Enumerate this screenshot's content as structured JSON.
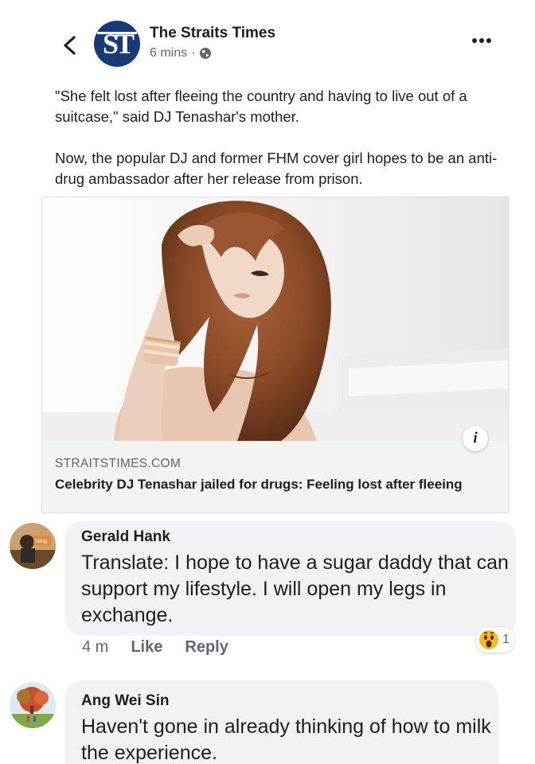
{
  "post": {
    "page_name": "The Straits Times",
    "logo_text": "ST",
    "time": "6 mins",
    "separator": "·",
    "paragraphs": [
      "\"She felt lost after fleeing the country and having to live out of a suitcase,\" said DJ Tenashar's mother.",
      "Now, the popular DJ and former FHM cover girl hopes to be an anti-drug ambassador after her release from prison."
    ],
    "link": {
      "domain": "STRAITSTIMES.COM",
      "title": "Celebrity DJ Tenashar jailed for drugs: Feeling lost after fleeing",
      "info_icon": "i"
    }
  },
  "comments": [
    {
      "name": "Gerald Hank",
      "avatar_label": "Yang",
      "text": "Translate: I hope to have a sugar daddy that can support my lifestyle. I will open my legs in exchange.",
      "time": "4 m",
      "like_label": "Like",
      "reply_label": "Reply",
      "reaction_icon": "wow-icon",
      "reaction_count": "1"
    },
    {
      "name": "Ang Wei Sin",
      "text": "Haven't gone in already thinking of how to milk the experience."
    }
  ],
  "colors": {
    "logo": "#1b3a75",
    "meta_text": "#606770",
    "bubble": "#f0f2f5",
    "wow": "#f7b928"
  }
}
